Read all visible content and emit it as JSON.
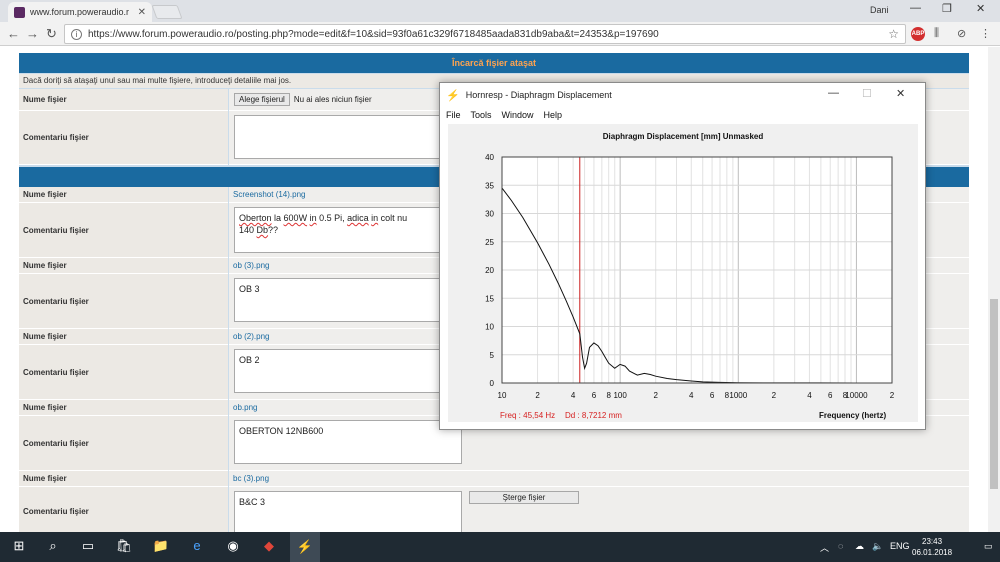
{
  "browser": {
    "tab_title": "www.forum.poweraudio.r",
    "user_name": "Dani",
    "url": "https://www.forum.poweraudio.ro/posting.php?mode=edit&f=10&sid=93f0a61c329f6718485aada831db9aba&t=24353&p=197690",
    "ext_abp": "ABP"
  },
  "forum": {
    "upload_header": "Încarcă fişier ataşat",
    "upload_note": "Dacă doriţi să ataşaţi unul sau mai multe fişiere, introduceţi detaliile mai jos.",
    "label_filename": "Nume fişier",
    "label_comment": "Comentariu fişier",
    "choose_file_btn": "Alege fişierul",
    "no_file_chosen": "Nu ai ales niciun fişier",
    "delete_btn": "Şterge fişier",
    "attachments": [
      {
        "file": "Screenshot (14).png",
        "comment_parts": [
          "Oberton",
          " la ",
          "600W",
          " ",
          "in",
          " 0.5 Pi, ",
          "adica",
          " ",
          "in",
          " colt nu",
          "140 ",
          "Db",
          "??"
        ]
      },
      {
        "file": "ob (3).png",
        "comment": "OB 3"
      },
      {
        "file": "ob (2).png",
        "comment": "OB 2"
      },
      {
        "file": "ob.png",
        "comment": "OBERTON 12NB600"
      },
      {
        "file": "bc (3).png",
        "comment": "B&C 3"
      }
    ]
  },
  "hornresp": {
    "title": "Hornresp - Diaphragm Displacement",
    "menu": [
      "File",
      "Tools",
      "Window",
      "Help"
    ],
    "plot_title": "Diaphragm Displacement [mm]   Unmasked",
    "freq_readout": "Freq : 45,54 Hz",
    "dd_readout": "Dd : 8,7212 mm",
    "xlabel": "Frequency (hertz)"
  },
  "chart_data": {
    "type": "line",
    "title": "Diaphragm Displacement [mm]   Unmasked",
    "xlabel": "Frequency (hertz)",
    "ylabel": "",
    "xscale": "log",
    "xlim": [
      10,
      20000
    ],
    "ylim": [
      0,
      40
    ],
    "y_ticks": [
      0,
      5,
      10,
      15,
      20,
      25,
      30,
      35,
      40
    ],
    "x_tick_labels": [
      {
        "x": 10,
        "label": "10"
      },
      {
        "x": 20,
        "label": "2"
      },
      {
        "x": 40,
        "label": "4"
      },
      {
        "x": 60,
        "label": "6"
      },
      {
        "x": 80,
        "label": "8"
      },
      {
        "x": 100,
        "label": "100"
      },
      {
        "x": 200,
        "label": "2"
      },
      {
        "x": 400,
        "label": "4"
      },
      {
        "x": 600,
        "label": "6"
      },
      {
        "x": 800,
        "label": "8"
      },
      {
        "x": 1000,
        "label": "1000"
      },
      {
        "x": 2000,
        "label": "2"
      },
      {
        "x": 4000,
        "label": "4"
      },
      {
        "x": 6000,
        "label": "6"
      },
      {
        "x": 8000,
        "label": "8"
      },
      {
        "x": 10000,
        "label": "10000"
      },
      {
        "x": 20000,
        "label": "2"
      }
    ],
    "cursor_x": 45.54,
    "grid": true,
    "series": [
      {
        "x": [
          10,
          12,
          15,
          20,
          25,
          30,
          35,
          40,
          45.54,
          48,
          50,
          52,
          55,
          60,
          65,
          70,
          75,
          80,
          90,
          100,
          110,
          120,
          140,
          160,
          180,
          200,
          250,
          300,
          400,
          500,
          700,
          1000,
          2000,
          5000,
          10000,
          20000
        ],
        "y": [
          34.5,
          32.3,
          29.3,
          24.8,
          21.0,
          17.6,
          14.5,
          11.7,
          8.7,
          4.6,
          2.6,
          3.5,
          6.3,
          7.1,
          6.6,
          5.6,
          4.5,
          3.5,
          2.6,
          3.3,
          3.0,
          2.1,
          1.4,
          1.7,
          1.5,
          1.2,
          0.8,
          0.6,
          0.35,
          0.2,
          0.1,
          0.05,
          0.02,
          0.01,
          0.0,
          0.0
        ]
      }
    ]
  },
  "taskbar": {
    "lang": "ENG",
    "time": "23:43",
    "date": "06.01.2018"
  }
}
